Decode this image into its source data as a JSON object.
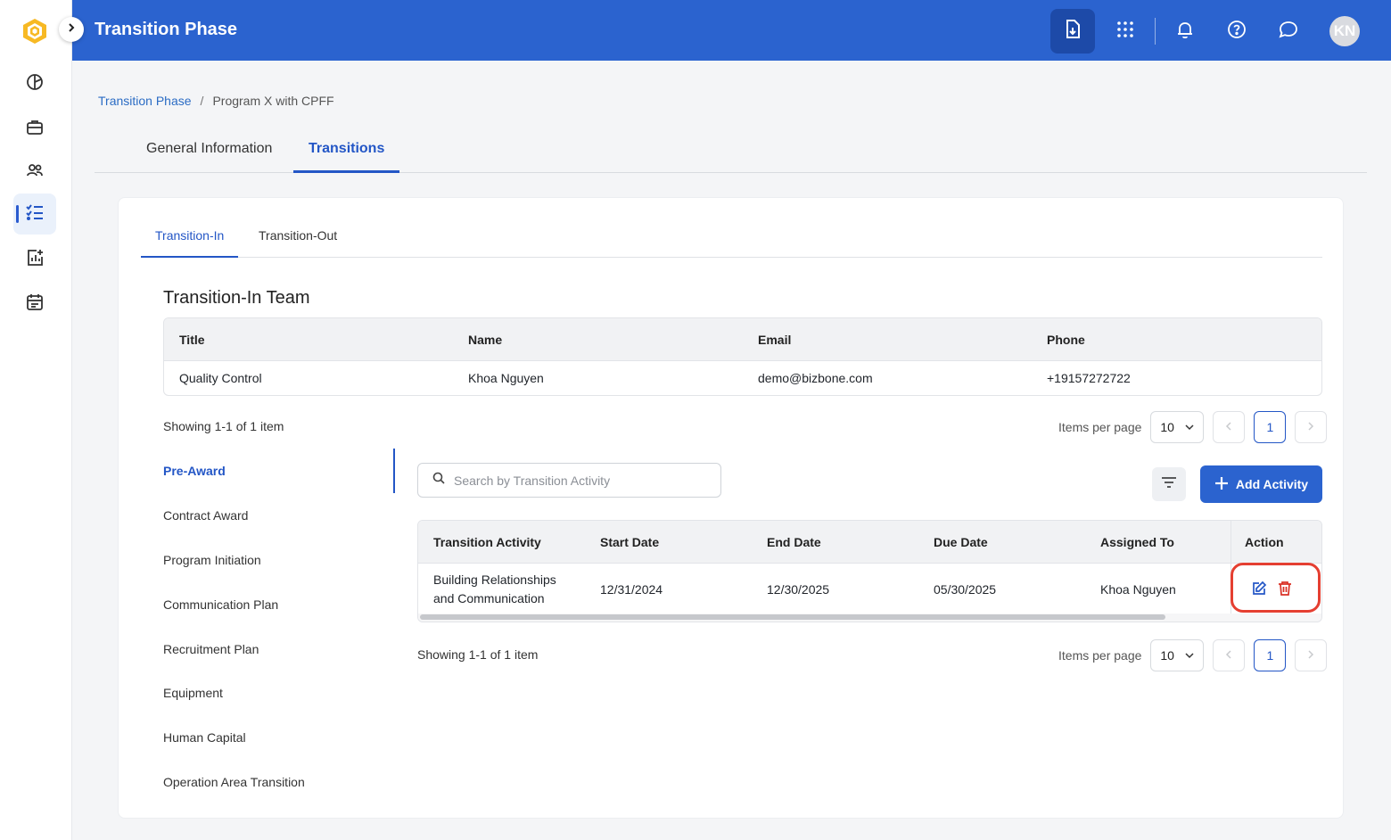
{
  "header": {
    "title": "Transition Phase",
    "avatar_initials": "KN",
    "color": "#2b63cf"
  },
  "sidebar": {
    "icons": [
      "dashboard-icon",
      "briefcase-icon",
      "users-icon",
      "checklist-icon",
      "analytics-icon",
      "calendar-icon"
    ],
    "active": "checklist-icon"
  },
  "breadcrumb": {
    "link": "Transition Phase",
    "separator": "/",
    "current": "Program X with CPFF"
  },
  "main_tabs": [
    {
      "label": "General Information",
      "active": false
    },
    {
      "label": "Transitions",
      "active": true
    }
  ],
  "sub_tabs": [
    {
      "label": "Transition-In",
      "active": true
    },
    {
      "label": "Transition-Out",
      "active": false
    }
  ],
  "team": {
    "title": "Transition-In Team",
    "columns": [
      "Title",
      "Name",
      "Email",
      "Phone"
    ],
    "rows": [
      [
        "Quality Control",
        "Khoa Nguyen",
        "demo@bizbone.com",
        "+19157272722"
      ]
    ],
    "showing": "Showing 1-1 of 1 item",
    "items_per_page_label": "Items per page",
    "items_per_page": "10",
    "page": "1"
  },
  "phases": [
    {
      "label": "Pre-Award",
      "active": true
    },
    {
      "label": "Contract Award",
      "active": false
    },
    {
      "label": "Program Initiation",
      "active": false
    },
    {
      "label": "Communication Plan",
      "active": false
    },
    {
      "label": "Recruitment Plan",
      "active": false
    },
    {
      "label": "Equipment",
      "active": false
    },
    {
      "label": "Human Capital",
      "active": false
    },
    {
      "label": "Operation Area Transition",
      "active": false
    }
  ],
  "activities": {
    "search_placeholder": "Search by Transition Activity",
    "add_label": "Add Activity",
    "columns": [
      "Transition Activity",
      "Start Date",
      "End Date",
      "Due Date",
      "Assigned To",
      "Action"
    ],
    "rows": [
      {
        "activity_line1": "Building Relationships",
        "activity_line2": "and Communication",
        "start": "12/31/2024",
        "end": "12/30/2025",
        "due": "05/30/2025",
        "assigned": "Khoa Nguyen"
      }
    ],
    "showing": "Showing 1-1 of 1 item",
    "items_per_page_label": "Items per page",
    "items_per_page": "10",
    "page": "1"
  },
  "colors": {
    "accent": "#2356c6",
    "delete": "#d93025",
    "highlight": "#e53f31"
  }
}
